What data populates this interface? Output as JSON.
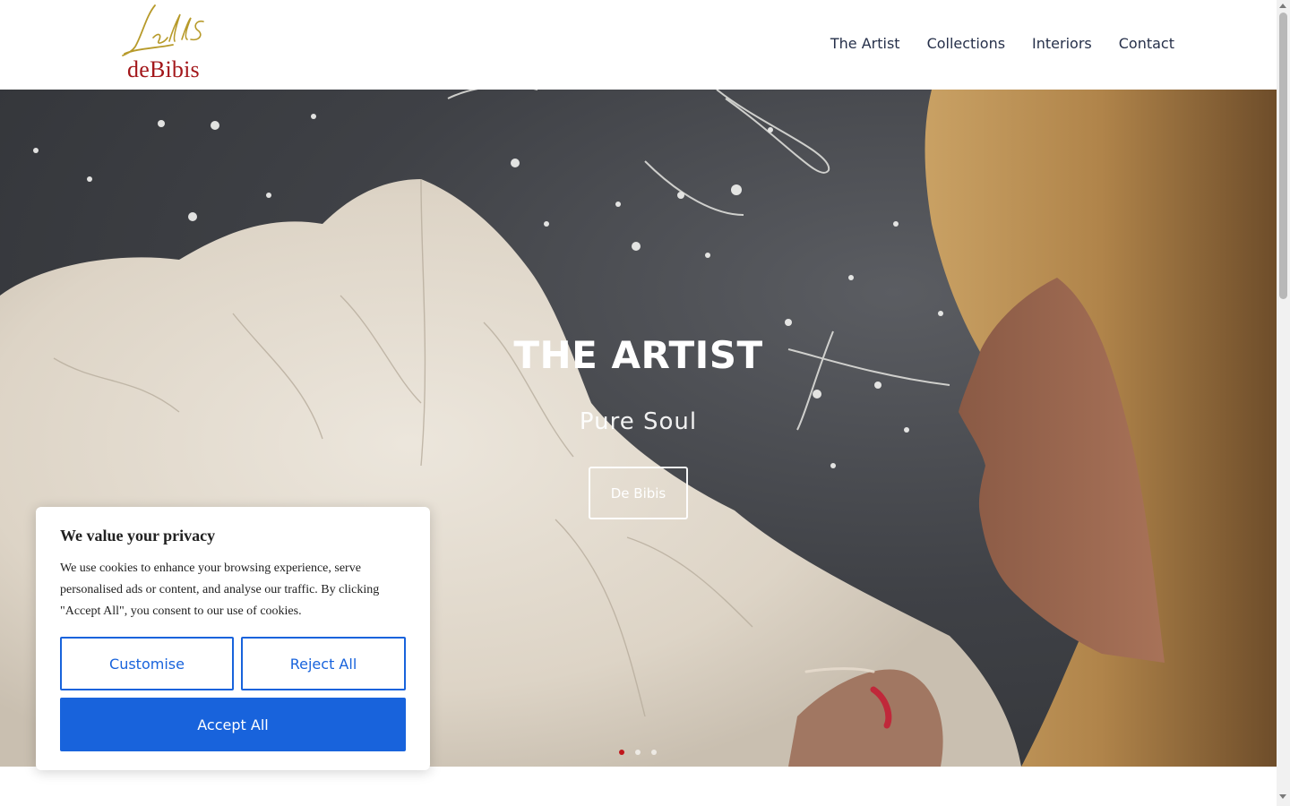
{
  "brand": {
    "logo_script_alt": "Jells",
    "logo_text": "deBibis",
    "logo_gold": "#b79a2a",
    "logo_red": "#a3171b"
  },
  "nav": {
    "items": [
      {
        "label": "The Artist"
      },
      {
        "label": "Collections"
      },
      {
        "label": "Interiors"
      },
      {
        "label": "Contact"
      }
    ]
  },
  "hero": {
    "title": "THE ARTIST",
    "subtitle": "Pure Soul",
    "button_label": "De Bibis",
    "slides_total": 3,
    "active_slide": 1,
    "active_dot_color": "#c0161b"
  },
  "cookie_banner": {
    "title": "We value your privacy",
    "text": "We use cookies to enhance your browsing experience, serve personalised ads or content, and analyse our traffic. By clicking \"Accept All\", you consent to our use of cookies.",
    "customise_label": "Customise",
    "reject_label": "Reject All",
    "accept_label": "Accept All",
    "accent_color": "#1863dc"
  }
}
